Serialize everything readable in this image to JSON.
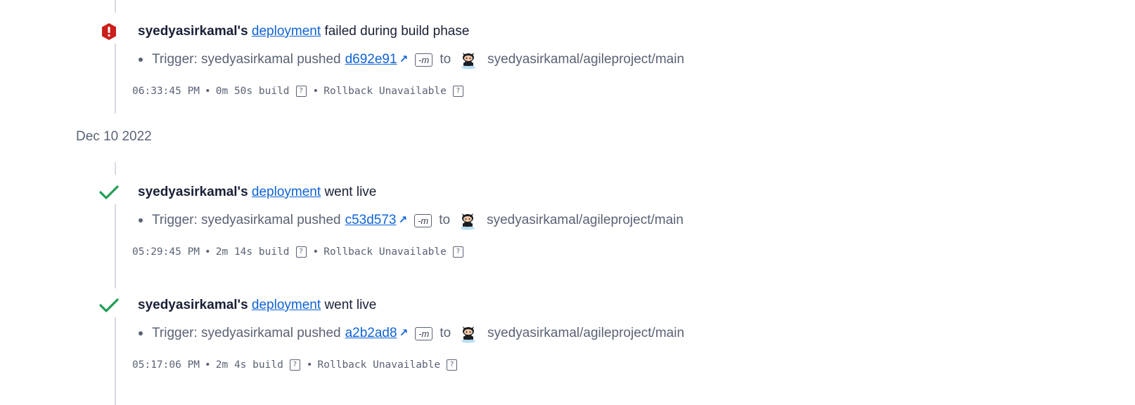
{
  "entries": [
    {
      "status": "failed",
      "status_icon": "error-icon",
      "status_color": "#cc1f1a",
      "user": "syedyasirkamal's",
      "link": "deployment",
      "result": "failed during build phase",
      "trigger_prefix": "Trigger: syedyasirkamal pushed",
      "commit": "d692e91",
      "msg_flag": "-m",
      "to_label": "to",
      "repo": "syedyasirkamal/agileproject/main",
      "time": "06:33:45 PM",
      "sep": "•",
      "build": "0m 50s build",
      "help": "?",
      "rollback": "Rollback Unavailable"
    },
    {
      "status": "live",
      "status_icon": "checkmark-icon",
      "status_color": "#1f9d55",
      "user": "syedyasirkamal's",
      "link": "deployment",
      "result": "went live",
      "trigger_prefix": "Trigger: syedyasirkamal pushed",
      "commit": "c53d573",
      "msg_flag": "-m",
      "to_label": "to",
      "repo": "syedyasirkamal/agileproject/main",
      "time": "05:29:45 PM",
      "sep": "•",
      "build": "2m 14s build",
      "help": "?",
      "rollback": "Rollback Unavailable"
    },
    {
      "status": "live",
      "status_icon": "checkmark-icon",
      "status_color": "#1f9d55",
      "user": "syedyasirkamal's",
      "link": "deployment",
      "result": "went live",
      "trigger_prefix": "Trigger: syedyasirkamal pushed",
      "commit": "a2b2ad8",
      "msg_flag": "-m",
      "to_label": "to",
      "repo": "syedyasirkamal/agileproject/main",
      "time": "05:17:06 PM",
      "sep": "•",
      "build": "2m 4s build",
      "help": "?",
      "rollback": "Rollback Unavailable"
    }
  ],
  "date_heading": "Dec 10 2022",
  "colors": {
    "link": "#0e63d6",
    "timeline": "#d7dbe3",
    "failed": "#cc1f1a",
    "success": "#1f9d55"
  }
}
